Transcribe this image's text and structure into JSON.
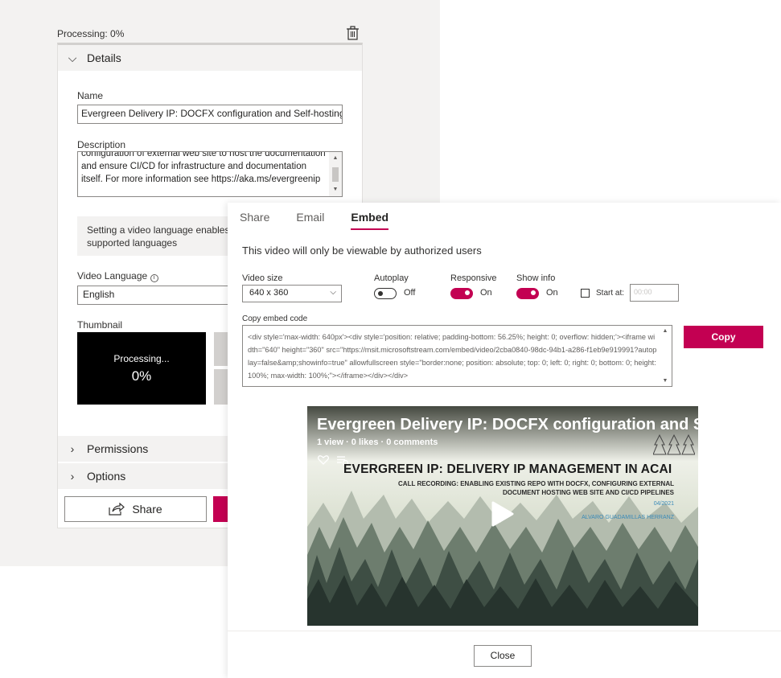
{
  "upload_form": {
    "processing_label": "Processing: 0%",
    "details": {
      "label": "Details"
    },
    "name_label": "Name",
    "name_value": "Evergreen Delivery IP: DOCFX configuration and Self-hosting",
    "description_label": "Description",
    "description_value": "configuration of external web site to host the documentation and ensure CI/CD for infrastructure and documentation itself. For more information see https://aka.ms/evergreenip",
    "language_info": "Setting a video language enables captioning for supported languages",
    "video_language_label": "Video Language",
    "video_language_value": "English",
    "thumbnail_label": "Thumbnail",
    "thumbnail_processing": "Processing...",
    "thumbnail_percent": "0%",
    "permissions_label": "Permissions",
    "options_label": "Options",
    "share_label": "Share"
  },
  "embed_dialog": {
    "tabs": [
      {
        "label": "Share",
        "active": false
      },
      {
        "label": "Email",
        "active": false
      },
      {
        "label": "Embed",
        "active": true
      }
    ],
    "auth_message": "This video will only be viewable by authorized users",
    "video_size_label": "Video size",
    "video_size_value": "640 x 360",
    "autoplay_label": "Autoplay",
    "autoplay_state": "Off",
    "responsive_label": "Responsive",
    "responsive_state": "On",
    "show_info_label": "Show info",
    "show_info_state": "On",
    "start_at_label": "Start at:",
    "start_at_placeholder": "00:00",
    "copy_embed_label": "Copy embed code",
    "embed_code": "<div style='max-width: 640px'><div style='position: relative; padding-bottom: 56.25%; height: 0; overflow: hidden;'><iframe width=\"640\" height=\"360\" src=\"https://msit.microsoftstream.com/embed/video/2cba0840-98dc-94b1-a286-f1eb9e919991?autoplay=false&amp;showinfo=true\" allowfullscreen style=\"border:none; position: absolute; top: 0; left: 0; right: 0; bottom: 0; height: 100%; max-width: 100%;\"></iframe></div></div>",
    "copy_label": "Copy",
    "close_label": "Close",
    "video": {
      "title": "Evergreen Delivery IP: DOCFX configuration and Self-hosting",
      "stats": "1 view · 0 likes · 0 comments",
      "slide_heading": "EVERGREEN IP: DELIVERY IP MANAGEMENT IN ACAI",
      "slide_subheading_1": "CALL RECORDING: ENABLING EXISTING REPO WITH DOCFX, CONFIGURING EXTERNAL",
      "slide_subheading_2": "DOCUMENT HOSTING WEB SITE AND CI/CD PIPELINES",
      "slide_date": "04/2021",
      "slide_author": "ALVARO GUADAMILLAS HERRANZ"
    }
  },
  "colors": {
    "accent": "#c30052",
    "panel_bg": "#f3f2f1"
  }
}
